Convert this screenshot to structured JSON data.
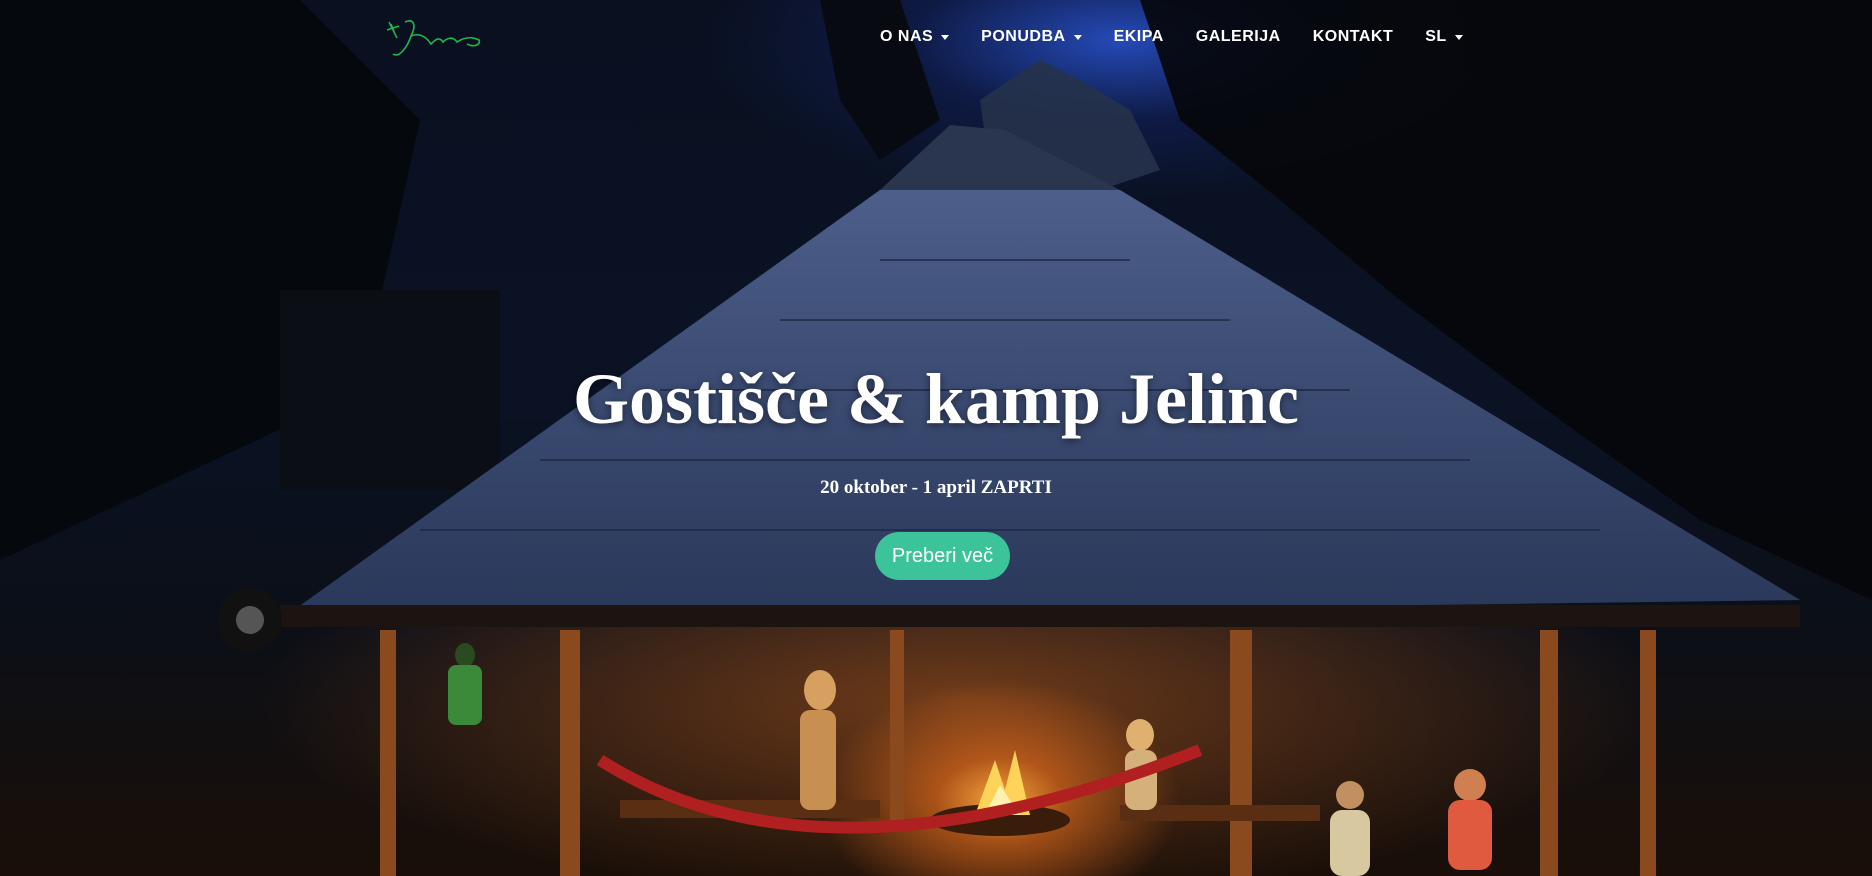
{
  "brand": {
    "logo_text": "Jelinc",
    "logo_color": "#1fb84a"
  },
  "nav": {
    "items": [
      {
        "label": "O NAS",
        "dropdown": true
      },
      {
        "label": "PONUDBA",
        "dropdown": true
      },
      {
        "label": "EKIPA",
        "dropdown": false
      },
      {
        "label": "GALERIJA",
        "dropdown": false
      },
      {
        "label": "KONTAKT",
        "dropdown": false
      },
      {
        "label": "SL",
        "dropdown": true
      }
    ]
  },
  "hero": {
    "title": "Gostišče & kamp Jelinc",
    "subtitle": "20 oktober - 1 april ZAPRTI",
    "cta_label": "Preberi več",
    "cta_color": "#3cc39a"
  }
}
